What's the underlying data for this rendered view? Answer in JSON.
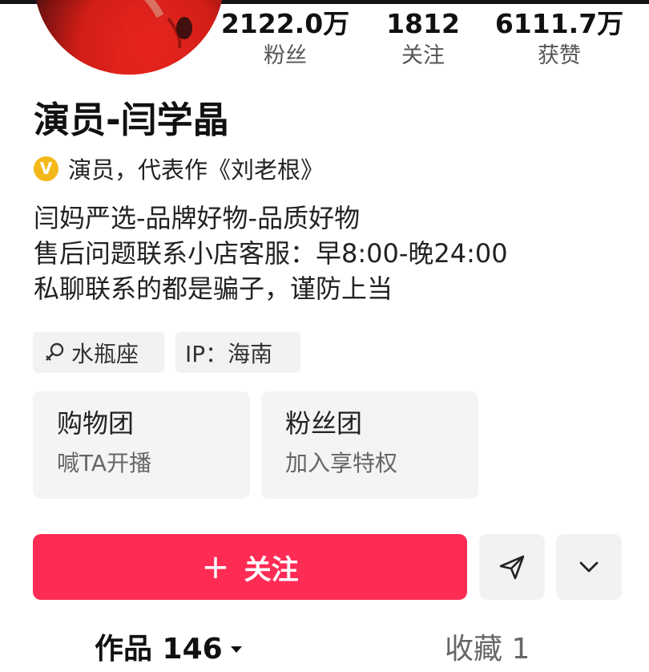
{
  "stats": {
    "fans": {
      "value": "2122.0万",
      "label": "粉丝"
    },
    "following": {
      "value": "1812",
      "label": "关注"
    },
    "likes": {
      "value": "6111.7万",
      "label": "获赞"
    }
  },
  "profile": {
    "name": "演员-闫学晶",
    "verify_badge": "V",
    "verify_text": "演员，代表作《刘老根》",
    "bio_lines": [
      "闫妈严选-品牌好物-品质好物",
      "售后问题联系小店客服：早8:00-晚24:00",
      "私聊联系的都是骗子，谨防上当"
    ]
  },
  "tags": {
    "zodiac": "水瓶座",
    "ip": "IP：海南"
  },
  "cards": {
    "shopping": {
      "title": "购物团",
      "subtitle": "喊TA开播"
    },
    "fanclub": {
      "title": "粉丝团",
      "subtitle": "加入享特权"
    }
  },
  "actions": {
    "follow_plus": "+",
    "follow_label": "关注"
  },
  "tabs": {
    "works": "作品 146",
    "favorites": "收藏 1"
  },
  "icons": {
    "share": "send-icon",
    "more": "chevron-down-icon",
    "zodiac": "aquarius-female-icon"
  },
  "colors": {
    "accent": "#fe2c55",
    "verify": "#f5b81a"
  }
}
